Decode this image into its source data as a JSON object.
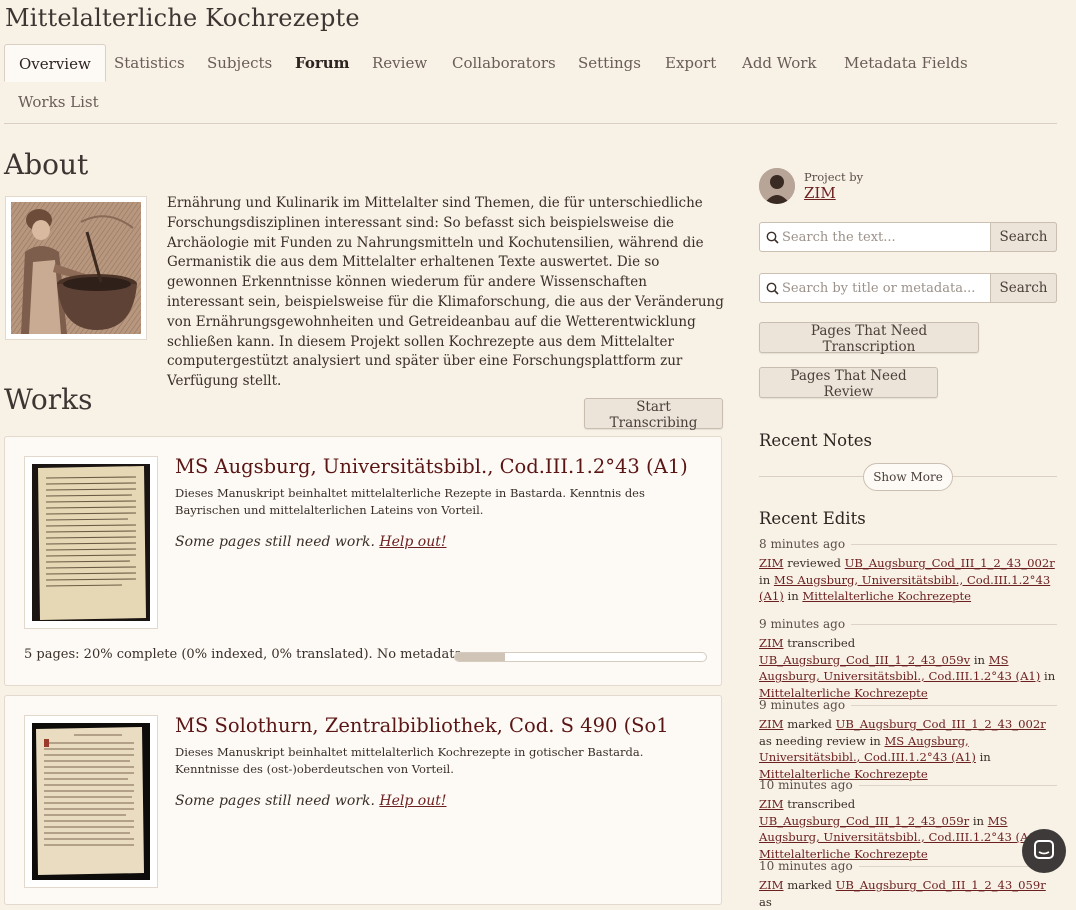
{
  "project_title": "Mittelalterliche Kochrezepte",
  "tabs": [
    {
      "label": "Overview"
    },
    {
      "label": "Statistics"
    },
    {
      "label": "Subjects"
    },
    {
      "label": "Forum"
    },
    {
      "label": "Review"
    },
    {
      "label": "Collaborators"
    },
    {
      "label": "Settings"
    },
    {
      "label": "Export"
    },
    {
      "label": "Add Work"
    },
    {
      "label": "Metadata Fields"
    },
    {
      "label": "Works List"
    }
  ],
  "about": {
    "heading": "About",
    "text": "Ernährung und Kulinarik im Mittelalter sind Themen, die für unterschiedliche Forschungsdisziplinen interessant sind: So befasst sich beispielsweise die Archäologie mit Funden zu Nahrungsmitteln und Kochutensilien, während die Germanistik die aus dem Mittelalter erhaltenen Texte auswertet. Die so gewonnen Erkenntnisse können wiederum für andere Wissenschaften interessant sein, beispielsweise für die Klimaforschung, die aus der Veränderung von Ernährungsgewohnheiten und Getreideanbau auf die Wetterentwicklung schließen kann. In diesem Projekt sollen Kochrezepte aus dem Mittelalter computergestützt analysiert und später über eine Forschungsplattform zur Verfügung stellt."
  },
  "works": {
    "heading": "Works",
    "start_button": "Start Transcribing",
    "items": [
      {
        "title": "MS Augsburg, Universitätsbibl., Cod.III.1.2°43 (A1)",
        "description": "Dieses Manuskript beinhaltet mittelalterliche Rezepte in Bastarda. Kenntnis des Bayrischen und mittelalterlichen Lateins von Vorteil.",
        "status_prefix": "Some pages still need work.",
        "help_link": "Help out!",
        "stats": "5 pages: 20% complete (0% indexed, 0% translated). No metadata.",
        "progress": 20
      },
      {
        "title": "MS Solothurn, Zentralbibliothek, Cod. S 490 (So1",
        "description": "Dieses Manuskript beinhaltet mittelalterlich Kochrezepte in gotischer Bastarda. Kenntnisse des (ost-)oberdeutschen von Vorteil.",
        "status_prefix": "Some pages still need work.",
        "help_link": "Help out!"
      }
    ]
  },
  "sidebar": {
    "project_by_label": "Project by",
    "owner": "ZIM",
    "search_text": {
      "placeholder": "Search the text...",
      "button": "Search"
    },
    "search_meta": {
      "placeholder": "Search by title or metadata...",
      "button": "Search"
    },
    "need_transcription": "Pages That Need Transcription",
    "need_review": "Pages That Need Review",
    "recent_notes": "Recent Notes",
    "show_more": "Show More",
    "recent_edits": "Recent Edits",
    "edits": [
      {
        "time": "8 minutes ago",
        "user": "ZIM",
        "action": "reviewed",
        "page": "UB_Augsburg_Cod_III_1_2_43_002r",
        "in1": "in",
        "work": "MS Augsburg, Universitätsbibl., Cod.III.1.2°43 (A1)",
        "in2": "in",
        "project": "Mittelalterliche Kochrezepte"
      },
      {
        "time": "9 minutes ago",
        "user": "ZIM",
        "action": "transcribed",
        "page": "UB_Augsburg_Cod_III_1_2_43_059v",
        "in1": "in",
        "work": "MS Augsburg, Universitätsbibl., Cod.III.1.2°43 (A1)",
        "in2": "in",
        "project": "Mittelalterliche Kochrezepte"
      },
      {
        "time": "9 minutes ago",
        "user": "ZIM",
        "action": "marked",
        "page": "UB_Augsburg_Cod_III_1_2_43_002r",
        "in1": "as needing review in",
        "work": "MS Augsburg, Universitätsbibl., Cod.III.1.2°43 (A1)",
        "in2": "in",
        "project": "Mittelalterliche Kochrezepte"
      },
      {
        "time": "10 minutes ago",
        "user": "ZIM",
        "action": "transcribed",
        "page": "UB_Augsburg_Cod_III_1_2_43_059r",
        "in1": "in",
        "work": "MS Augsburg, Universitätsbibl., Cod.III.1.2°43 (A1)",
        "in2": "in",
        "project": "Mittelalterliche Kochrezepte"
      },
      {
        "time": "10 minutes ago",
        "user": "ZIM",
        "action": "marked",
        "page": "UB_Augsburg_Cod_III_1_2_43_059r",
        "in1": "as"
      }
    ]
  },
  "colors": {
    "background": "#f7f1e6",
    "link": "#6b1f1f",
    "card": "#fdfaf5"
  }
}
